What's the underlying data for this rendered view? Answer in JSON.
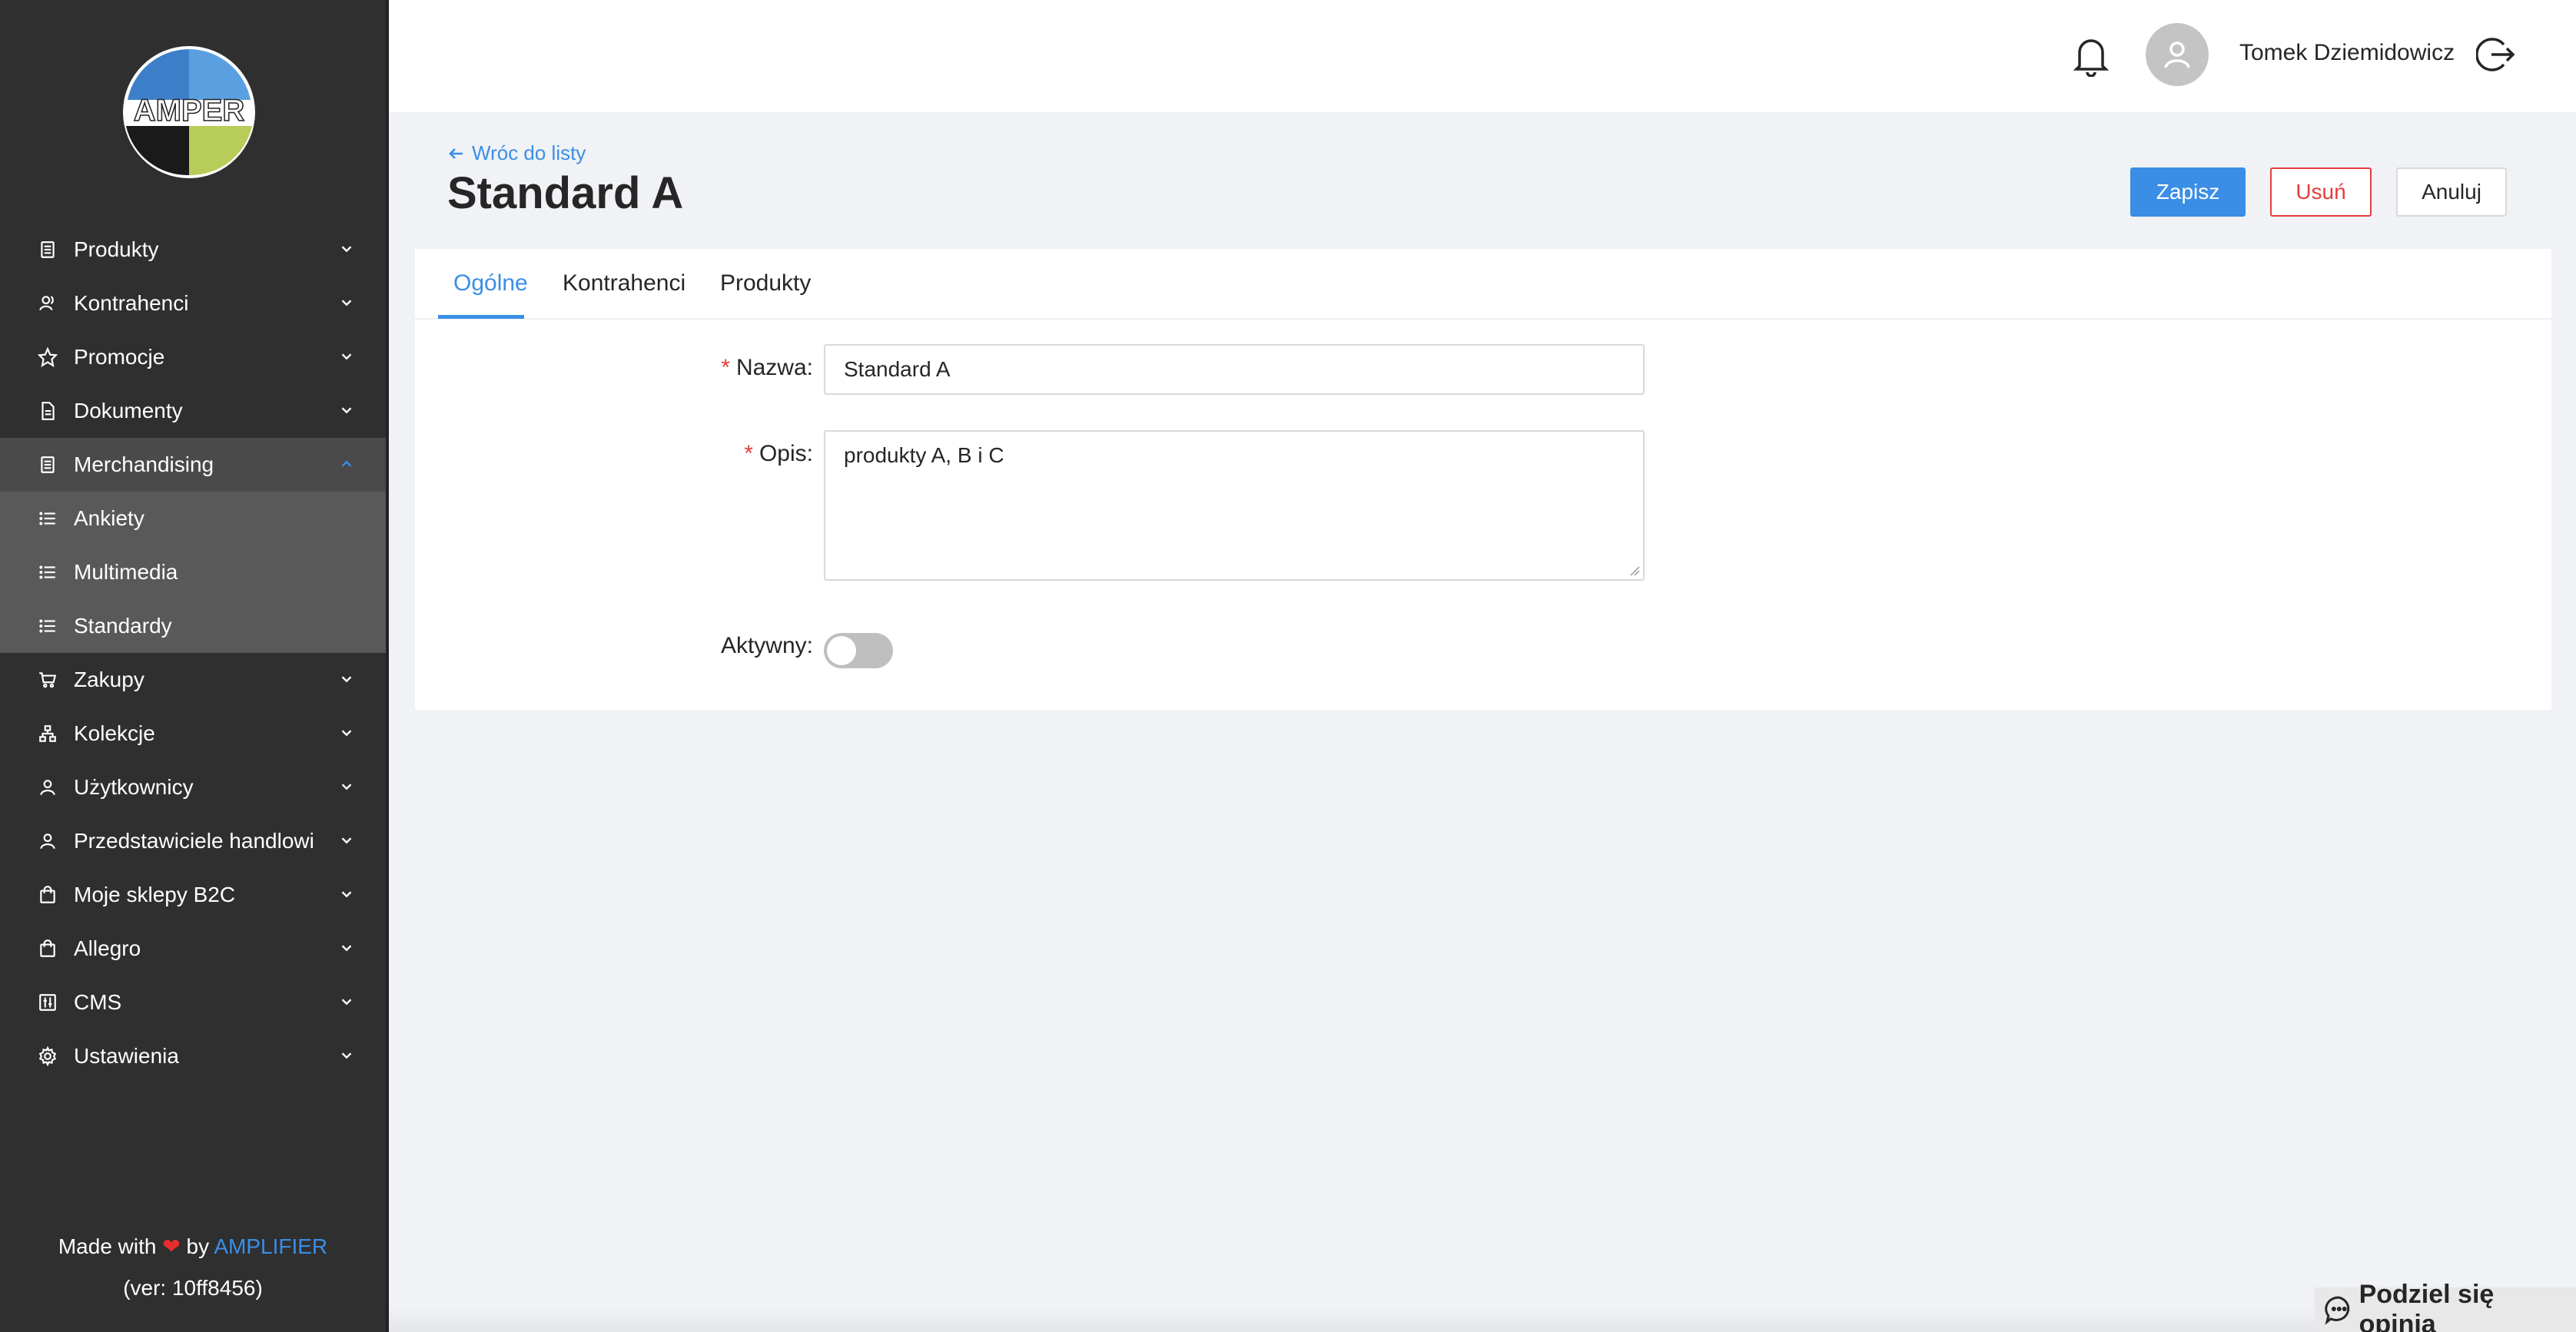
{
  "app": {
    "logo_text": "AMPER"
  },
  "sidebar": {
    "items": [
      {
        "label": "Produkty",
        "icon": "document-icon"
      },
      {
        "label": "Kontrahenci",
        "icon": "contacts-icon"
      },
      {
        "label": "Promocje",
        "icon": "star-icon"
      },
      {
        "label": "Dokumenty",
        "icon": "file-icon"
      },
      {
        "label": "Merchandising",
        "icon": "document-icon",
        "expanded": true
      },
      {
        "label": "Zakupy",
        "icon": "cart-icon"
      },
      {
        "label": "Kolekcje",
        "icon": "hierarchy-icon"
      },
      {
        "label": "Użytkownicy",
        "icon": "user-icon"
      },
      {
        "label": "Przedstawiciele handlowi",
        "icon": "user-icon"
      },
      {
        "label": "Moje sklepy B2C",
        "icon": "bag-icon"
      },
      {
        "label": "Allegro",
        "icon": "bag-icon"
      },
      {
        "label": "CMS",
        "icon": "sliders-icon"
      },
      {
        "label": "Ustawienia",
        "icon": "gear-icon"
      }
    ],
    "submenu": [
      {
        "label": "Ankiety",
        "icon": "list-icon"
      },
      {
        "label": "Multimedia",
        "icon": "list-icon"
      },
      {
        "label": "Standardy",
        "icon": "list-icon"
      }
    ],
    "footer": {
      "made_with": "Made with",
      "by": "by",
      "brand": "AMPLIFIER",
      "version": "(ver: 10ff8456)"
    }
  },
  "header": {
    "username": "Tomek Dziemidowicz"
  },
  "page": {
    "back_label": "Wróc do listy",
    "title": "Standard A",
    "buttons": {
      "save": "Zapisz",
      "delete": "Usuń",
      "cancel": "Anuluj"
    }
  },
  "tabs": [
    {
      "label": "Ogólne",
      "active": true
    },
    {
      "label": "Kontrahenci",
      "active": false
    },
    {
      "label": "Produkty",
      "active": false
    }
  ],
  "form": {
    "name_label": "Nazwa",
    "name_value": "Standard A",
    "desc_label": "Opis",
    "desc_value": "produkty A, B i C",
    "active_label": "Aktywny",
    "active_value": false,
    "colon": ":"
  },
  "feedback": {
    "label": "Podziel się opinią"
  },
  "colors": {
    "accent": "#3a8ee6",
    "danger": "#e63c3c",
    "sidebar": "#2f2f2f"
  }
}
